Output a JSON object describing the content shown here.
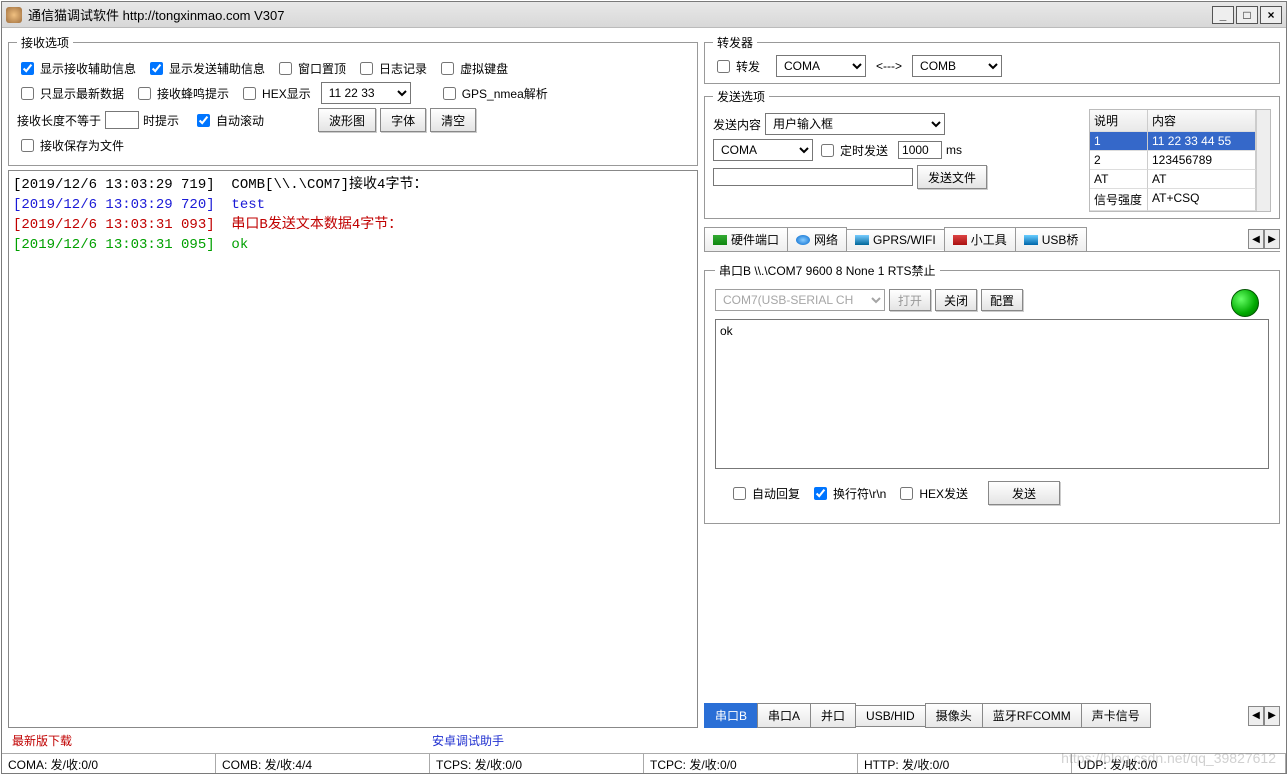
{
  "window": {
    "title": "通信猫调试软件  http://tongxinmao.com  V307"
  },
  "recv": {
    "legend": "接收选项",
    "chk_show_recv_aux": "显示接收辅助信息",
    "chk_show_send_aux": "显示发送辅助信息",
    "chk_topmost": "窗口置顶",
    "chk_log": "日志记录",
    "chk_vkbd": "虚拟键盘",
    "chk_only_new": "只显示最新数据",
    "chk_beep": "接收蜂鸣提示",
    "chk_hex": "HEX显示",
    "hex_combo": "11 22 33",
    "chk_gps": "GPS_nmea解析",
    "len_label_a": "接收长度不等于",
    "len_label_b": "时提示",
    "chk_autoscroll": "自动滚动",
    "btn_wave": "波形图",
    "btn_font": "字体",
    "btn_clear": "清空",
    "chk_savefile": "接收保存为文件"
  },
  "log": [
    {
      "cls": "c-black",
      "ts": "[2019/12/6 13:03:29 719]",
      "msg": "  COMB[\\\\.\\COM7]接收4字节："
    },
    {
      "cls": "c-blue",
      "ts": "[2019/12/6 13:03:29 720]",
      "msg": "  test"
    },
    {
      "cls": "c-red",
      "ts": "[2019/12/6 13:03:31 093]",
      "msg": "  串口B发送文本数据4字节："
    },
    {
      "cls": "c-green",
      "ts": "[2019/12/6 13:03:31 095]",
      "msg": "  ok"
    }
  ],
  "fwd": {
    "legend": "转发器",
    "chk_fwd": "转发",
    "a": "COMA",
    "arrow": "<--->",
    "b": "COMB"
  },
  "send": {
    "legend": "发送选项",
    "content_label": "发送内容",
    "content_combo": "用户输入框",
    "port_combo": "COMA",
    "chk_timer": "定时发送",
    "timer_val": "1000",
    "timer_unit": "ms",
    "btn_sendfile": "发送文件",
    "grid_head": {
      "c1": "说明",
      "c2": "内容"
    },
    "grid_rows": [
      {
        "c1": "1",
        "c2": "11 22 33 44 55",
        "sel": true
      },
      {
        "c1": "2",
        "c2": "123456789"
      },
      {
        "c1": "AT",
        "c2": "AT"
      },
      {
        "c1": "信号强度",
        "c2": "AT+CSQ"
      }
    ]
  },
  "tabs": {
    "hw": "硬件端口",
    "net": "网络",
    "gprs": "GPRS/WIFI",
    "tool": "小工具",
    "usb": "USB桥"
  },
  "serial": {
    "legend": "串口B \\\\.\\COM7 9600 8  None  1 RTS禁止",
    "port": "COM7(USB-SERIAL CH",
    "btn_open": "打开",
    "btn_close": "关闭",
    "btn_cfg": "配置",
    "text": "ok",
    "chk_autoreply": "自动回复",
    "chk_crlf": "换行符\\r\\n",
    "chk_hexsend": "HEX发送",
    "btn_send": "发送"
  },
  "btabs": [
    "串口B",
    "串口A",
    "并口",
    "USB/HID",
    "摄像头",
    "蓝牙RFCOMM",
    "声卡信号"
  ],
  "footer": {
    "link1": "最新版下载",
    "link2": "安卓调试助手"
  },
  "status": [
    "COMA: 发/收:0/0",
    "COMB: 发/收:4/4",
    "TCPS: 发/收:0/0",
    "TCPC: 发/收:0/0",
    "HTTP: 发/收:0/0",
    "UDP: 发/收:0/0"
  ],
  "watermark": "https://blog.csdn.net/qq_39827612"
}
